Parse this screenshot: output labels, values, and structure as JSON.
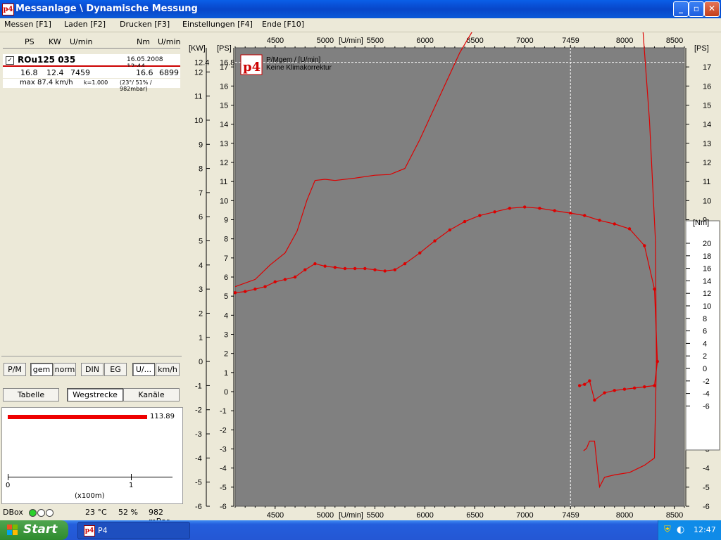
{
  "window": {
    "title": "Messanlage \\ Dynamische Messung",
    "icon_text": "p4",
    "minimize": "_",
    "maximize": "▫",
    "close": "✕"
  },
  "menu": [
    "Messen [F1]",
    "Laden [F2]",
    "Drucken [F3]",
    "Einstellungen [F4]",
    "Ende [F10]"
  ],
  "table": {
    "headers": [
      "PS",
      "KW",
      "U/min",
      "Nm",
      "U/min"
    ],
    "run_name": "ROu125 035",
    "run_date": "16.05.2008 12:44",
    "values": [
      "16.8",
      "12.4",
      "7459",
      "16.6",
      "6899"
    ],
    "max_speed": "max 87.4 km/h",
    "k_factor": "k=1.000",
    "conditions": "(23°/ 51% / 982mbar)"
  },
  "toggle_buttons": [
    "P/M",
    "gem",
    "norm",
    "DIN",
    "EG",
    "U/...",
    "km/h"
  ],
  "view_buttons": [
    "Tabelle",
    "Wegstrecke",
    "Kanäle"
  ],
  "progress": {
    "value": 113.89,
    "label": "113.89",
    "scale_start": "0",
    "scale_end": "1",
    "scale_unit": "(x100m)"
  },
  "status": {
    "dbox": "DBox",
    "temperature": "23 °C",
    "humidity": "52 %",
    "pressure": "982 mBar"
  },
  "taskbar": {
    "start": "Start",
    "task": "P4",
    "clock": "12:47"
  },
  "chart_data": {
    "type": "line",
    "legend_title": "P/Mgem / [U/min]",
    "legend_subtitle": "Keine Klimakorrektur",
    "xlabel": "[U/min]",
    "xticks": [
      "4500",
      "5000",
      "5500",
      "6000",
      "6500",
      "7000",
      "7459",
      "8000",
      "8500"
    ],
    "xlim": [
      4100,
      8600
    ],
    "marker_x": 7459,
    "marker_label": "7459",
    "axes": {
      "kw": {
        "label": "[KW]",
        "lim": [
          -6,
          13
        ],
        "max_label": "12.4"
      },
      "ps_left": {
        "label": "[PS]",
        "max_label": "16.8"
      },
      "ps_right": {
        "label": "[PS]",
        "lim": [
          -6,
          18
        ]
      },
      "nm": {
        "label": "[Nm]",
        "ticks": [
          "20",
          "18",
          "16",
          "14",
          "12",
          "10",
          "8",
          "6",
          "4",
          "2",
          "0",
          "-2",
          "-4",
          "-6"
        ]
      }
    },
    "marker_kw": 12.4,
    "series": [
      {
        "name": "P",
        "color": "#DD0000",
        "markers": false,
        "y_axis": "kw",
        "points": [
          [
            4100,
            3.1
          ],
          [
            4300,
            3.4
          ],
          [
            4450,
            4.0
          ],
          [
            4600,
            4.5
          ],
          [
            4720,
            5.4
          ],
          [
            4820,
            6.7
          ],
          [
            4900,
            7.5
          ],
          [
            5000,
            7.55
          ],
          [
            5100,
            7.5
          ],
          [
            5300,
            7.6
          ],
          [
            5500,
            7.72
          ],
          [
            5650,
            7.75
          ],
          [
            5800,
            8.0
          ],
          [
            5950,
            9.2
          ],
          [
            6150,
            11.0
          ],
          [
            6350,
            12.8
          ],
          [
            6550,
            14.2
          ],
          [
            6750,
            15.6
          ],
          [
            6900,
            16.5
          ],
          [
            7100,
            16.9
          ],
          [
            7300,
            17.0
          ],
          [
            7459,
            17.0
          ],
          [
            7650,
            16.9
          ],
          [
            7900,
            16.5
          ],
          [
            8050,
            16.15
          ],
          [
            8150,
            15.7
          ],
          [
            8250,
            10.0
          ],
          [
            8310,
            5.0
          ],
          [
            8320,
            0.0
          ],
          [
            8300,
            -4.0
          ],
          [
            8200,
            -4.3
          ],
          [
            8050,
            -4.6
          ],
          [
            7900,
            -4.7
          ],
          [
            7800,
            -4.8
          ],
          [
            7750,
            -5.2
          ],
          [
            7730,
            -4.5
          ],
          [
            7700,
            -3.3
          ],
          [
            7650,
            -3.3
          ],
          [
            7620,
            -3.6
          ],
          [
            7590,
            -3.7
          ]
        ]
      },
      {
        "name": "M",
        "color": "#DD0000",
        "markers": true,
        "y_axis": "kw",
        "points": [
          [
            4100,
            2.85
          ],
          [
            4200,
            2.9
          ],
          [
            4300,
            3.0
          ],
          [
            4400,
            3.1
          ],
          [
            4500,
            3.3
          ],
          [
            4600,
            3.4
          ],
          [
            4700,
            3.5
          ],
          [
            4800,
            3.8
          ],
          [
            4900,
            4.05
          ],
          [
            5000,
            3.95
          ],
          [
            5100,
            3.9
          ],
          [
            5200,
            3.85
          ],
          [
            5300,
            3.85
          ],
          [
            5400,
            3.85
          ],
          [
            5500,
            3.8
          ],
          [
            5600,
            3.75
          ],
          [
            5700,
            3.8
          ],
          [
            5800,
            4.05
          ],
          [
            5950,
            4.5
          ],
          [
            6100,
            5.0
          ],
          [
            6250,
            5.45
          ],
          [
            6400,
            5.8
          ],
          [
            6550,
            6.05
          ],
          [
            6700,
            6.2
          ],
          [
            6850,
            6.35
          ],
          [
            7000,
            6.4
          ],
          [
            7150,
            6.35
          ],
          [
            7300,
            6.25
          ],
          [
            7459,
            6.15
          ],
          [
            7600,
            6.05
          ],
          [
            7750,
            5.85
          ],
          [
            7900,
            5.7
          ],
          [
            8050,
            5.5
          ],
          [
            8200,
            4.8
          ],
          [
            8300,
            3.0
          ],
          [
            8330,
            0.0
          ],
          [
            8300,
            -1.0
          ],
          [
            8200,
            -1.05
          ],
          [
            8100,
            -1.1
          ],
          [
            8000,
            -1.15
          ],
          [
            7900,
            -1.2
          ],
          [
            7800,
            -1.3
          ],
          [
            7700,
            -1.6
          ],
          [
            7650,
            -0.8
          ],
          [
            7600,
            -0.95
          ],
          [
            7550,
            -1.0
          ]
        ]
      }
    ]
  }
}
